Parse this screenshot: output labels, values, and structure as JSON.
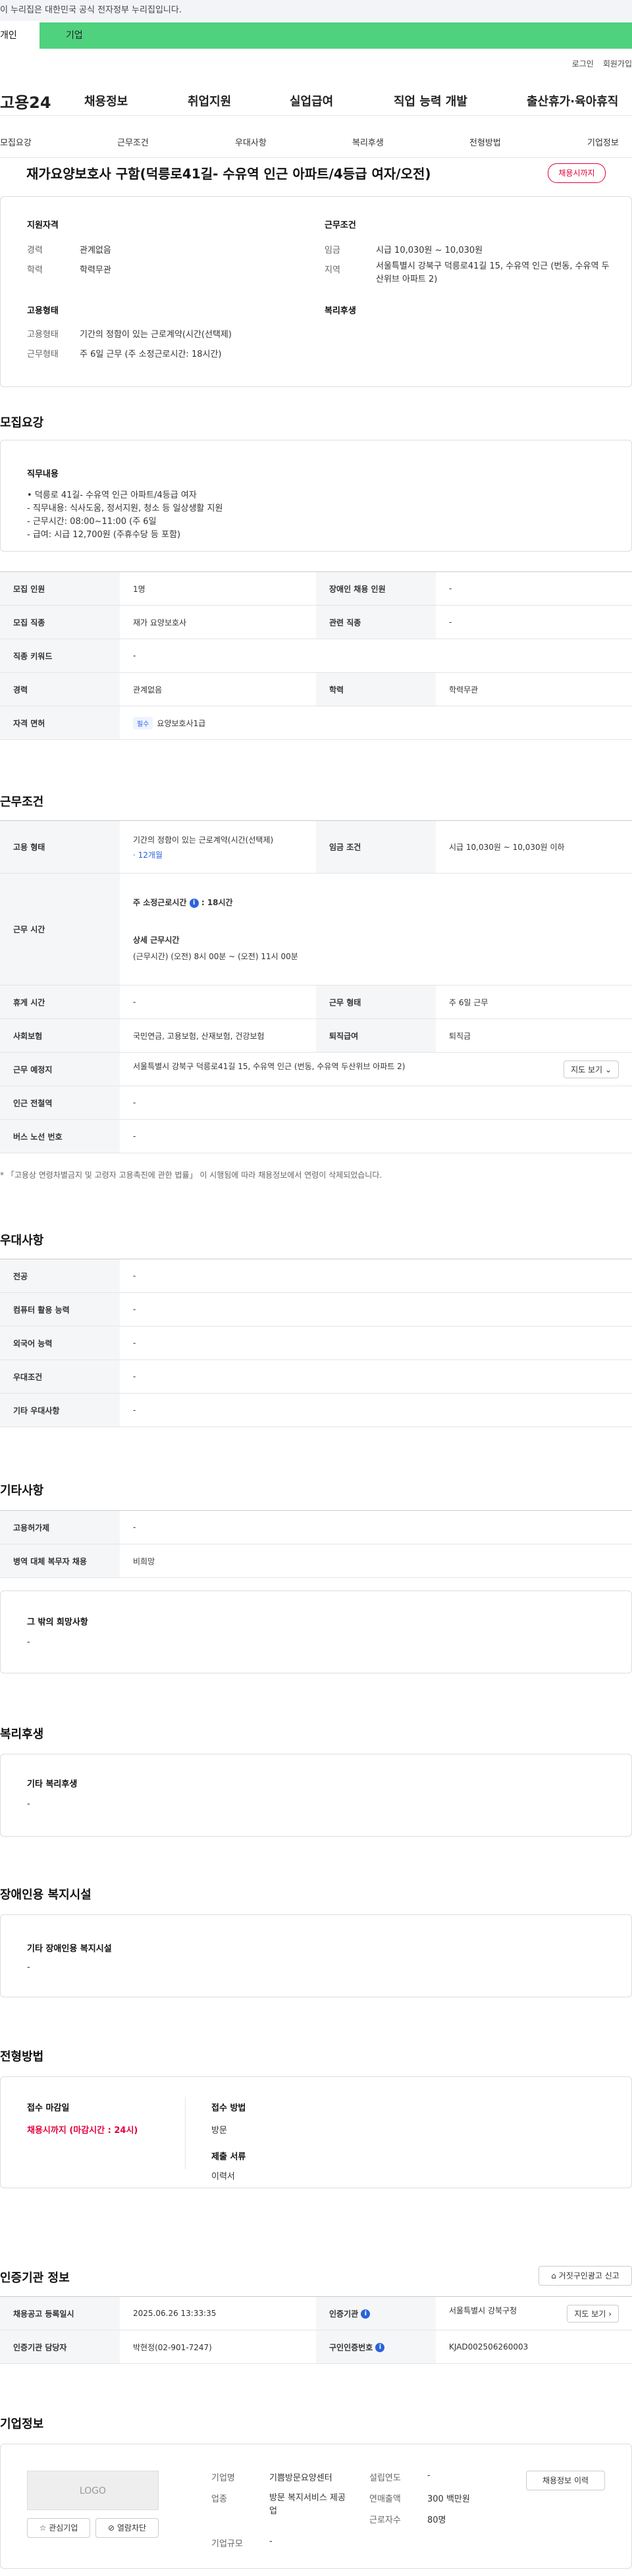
{
  "gov_banner": "이 누리집은 대한민국 공식 전자정부 누리집입니다.",
  "user_tabs": [
    "개인",
    "기업"
  ],
  "util": [
    "로그인",
    "회원가입"
  ],
  "gnb": {
    "logo": "고용24",
    "menu": [
      "채용정보",
      "취업지원",
      "실업급여",
      "직업 능력 개발",
      "출산휴가·육아휴직"
    ]
  },
  "lnb": [
    "모집요강",
    "근무조건",
    "우대사항",
    "복리후생",
    "전형방법",
    "기업정보"
  ],
  "job": {
    "title": "재가요양보호사 구함(덕릉로41길- 수유역 인근 아파트/4등급 여자/오전)",
    "status": "채용시까지"
  },
  "summary": {
    "qual_h": "지원자격",
    "career_l": "경력",
    "career_v": "관계없음",
    "edu_l": "학력",
    "edu_v": "학력무관",
    "work_h": "근무조건",
    "wage_l": "임금",
    "wage_v": "시급 10,030원 ~ 10,030원",
    "region_l": "지역",
    "region_v": "서울특별시 강북구 덕릉로41길 15, 수유역 인근 (번동, 수유역 두산위브 아파트 2)",
    "emp_h": "고용형태",
    "emp_l": "고용형태",
    "emp_v": "기간의 정함이 있는 근로계약(시간(선택제)",
    "hours_l": "근무형태",
    "hours_v": "주 6일 근무 (주 소정근로시간: 18시간)",
    "welfare_h": "복리후생"
  },
  "recruit": {
    "h": "모집요강",
    "duty_h": "직무내용",
    "duty_lines": [
      "• 덕릉로 41길- 수유역 인근 아파트/4등급 여자",
      "- 직무내용: 식사도움, 정서지원, 청소 등 일상생활 지원",
      "- 근무시간: 08:00~11:00 (주 6일",
      "- 급여: 시급 12,700원 (주휴수당  등 포함)"
    ],
    "rows": [
      [
        "모집 인원",
        "1명",
        "장애인 채용 인원",
        "-"
      ],
      [
        "모집 직종",
        "재가 요양보호사",
        "관련 직종",
        "-"
      ],
      [
        "직종 키워드",
        "-"
      ],
      [
        "경력",
        "관계없음",
        "학력",
        "학력무관"
      ]
    ],
    "license_l": "자격 면허",
    "license_tag": "필수",
    "license_v": "요양보호사1급"
  },
  "conditions": {
    "h": "근무조건",
    "emp_l": "고용 형태",
    "emp_v": "기간의 정함이 있는 근로계약(시간(선택제)",
    "emp_period": "· 12개월",
    "wage_l": "임금 조건",
    "wage_v": "시급 10,030원 ~ 10,030원 이하",
    "time_l": "근무 시간",
    "time_week": "주 소정근로시간",
    "time_week_v": "18시간",
    "time_detail_h": "상세 근무시간",
    "time_detail_v": "(근무시간) (오전) 8시 00분 ~ (오전) 11시 00분",
    "rows": [
      [
        "휴게 시간",
        "-",
        "근무 형태",
        "주 6일 근무"
      ],
      [
        "사회보험",
        "국민연금, 고용보험, 산재보험, 건강보험",
        "퇴직급여",
        "퇴직금"
      ]
    ],
    "place_l": "근무 예정지",
    "place_v": "서울특별시 강북구 덕릉로41길 15, 수유역 인근 (번동, 수유역 두산위브 아파트 2)",
    "map_btn": "지도 보기",
    "station_l": "인근 전철역",
    "station_v": "-",
    "bus_l": "버스 노선 번호",
    "bus_v": "-",
    "note": "* 「고용상 연령차별금지 및 고령자 고용촉진에 관한 법률」 이 시행됨에 따라 채용정보에서 연령이 삭제되었습니다."
  },
  "preference": {
    "h": "우대사항",
    "rows": [
      [
        "전공",
        "-"
      ],
      [
        "컴퓨터 활용 능력",
        "-"
      ],
      [
        "외국어 능력",
        "-"
      ],
      [
        "우대조건",
        "-"
      ],
      [
        "기타 우대사항",
        "-"
      ]
    ]
  },
  "etc": {
    "h": "기타사항",
    "rows": [
      [
        "고용허가제",
        "-"
      ],
      [
        "병역 대체 복무자 채용",
        "비희망"
      ]
    ],
    "other_h": "그 밖의 희망사항",
    "other_v": "-"
  },
  "welfare": {
    "h": "복리후생",
    "sub": "기타 복리후생",
    "v": "-"
  },
  "disabled": {
    "h": "장애인용 복지시설",
    "sub": "기타 장애인용 복지시설",
    "v": "-"
  },
  "process": {
    "h": "전형방법",
    "deadline_h": "접수 마감일",
    "deadline_v": "채용시까지 (마감시간 : 24시)",
    "method_h": "접수 방법",
    "method_v": "방문",
    "docs_h": "제출 서류",
    "docs_v": "이력서"
  },
  "cert": {
    "h": "인증기관 정보",
    "report_btn": "거짓구인광고 신고",
    "reg_l": "채용공고 등록일시",
    "reg_v": "2025.06.26 13:33:35",
    "agency_l": "인증기관",
    "agency_v": "서울특별시 강북구청",
    "map_btn": "지도 보기",
    "staff_l": "인증기관 담당자",
    "staff_v": "박현정(02-901-7247)",
    "no_l": "구인인증번호",
    "no_v": "KJAD002506260003"
  },
  "company": {
    "h": "기업정보",
    "logo": "LOGO",
    "fav_btn": "관심기업",
    "block_btn": "열람차단",
    "name_l": "기업명",
    "name_v": "기쁨방문요양센터",
    "ind_l": "업종",
    "ind_v": "방문 복지서비스 제공업",
    "size_l": "기업규모",
    "size_v": "-",
    "est_l": "설립연도",
    "est_v": "-",
    "sales_l": "연매출액",
    "sales_v": "300 백만원",
    "emp_l": "근로자수",
    "emp_v": "80명",
    "hist_btn": "채용정보 이력"
  }
}
